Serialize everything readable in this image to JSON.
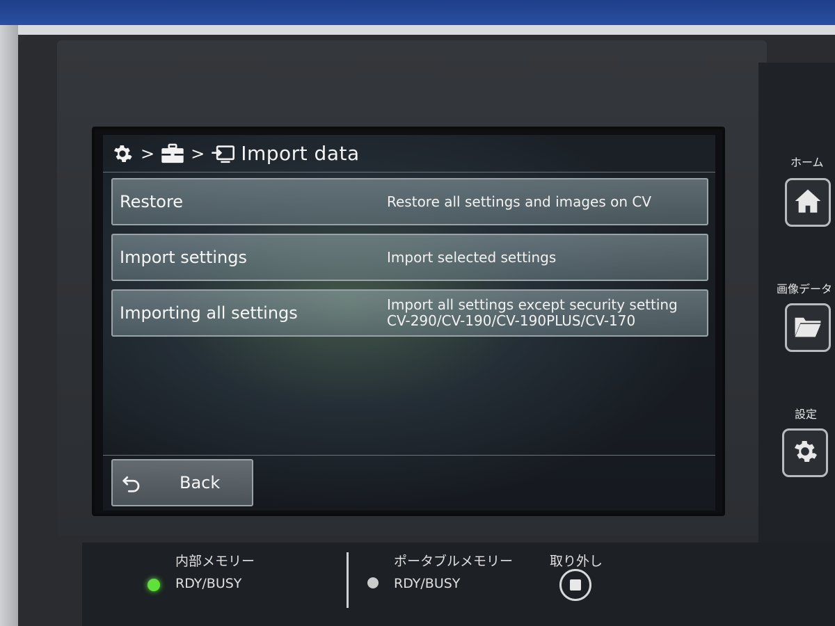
{
  "screen": {
    "title": "Import data",
    "breadcrumb_separator": ">",
    "breadcrumb_icons": [
      "gear-icon",
      "toolbox-icon",
      "import-icon"
    ],
    "menu": [
      {
        "label": "Restore",
        "description_lines": [
          "Restore all settings and images on CV"
        ]
      },
      {
        "label": "Import settings",
        "description_lines": [
          "Import selected settings"
        ]
      },
      {
        "label": "Importing all settings",
        "description_lines": [
          "Import all settings except security setting",
          "CV-290/CV-190/CV-190PLUS/CV-170"
        ]
      }
    ],
    "back_label": "Back"
  },
  "hardware": {
    "home_label": "ホーム",
    "image_data_label": "画像データ",
    "settings_label": "設定",
    "internal_memory_label": "内部メモリー",
    "internal_status": "RDY/BUSY",
    "portable_memory_label": "ポータブルメモリー",
    "portable_status": "RDY/BUSY",
    "eject_label": "取り外し"
  },
  "colors": {
    "internal_led": "#5fe03a",
    "portable_led": "#c9cbcd"
  }
}
